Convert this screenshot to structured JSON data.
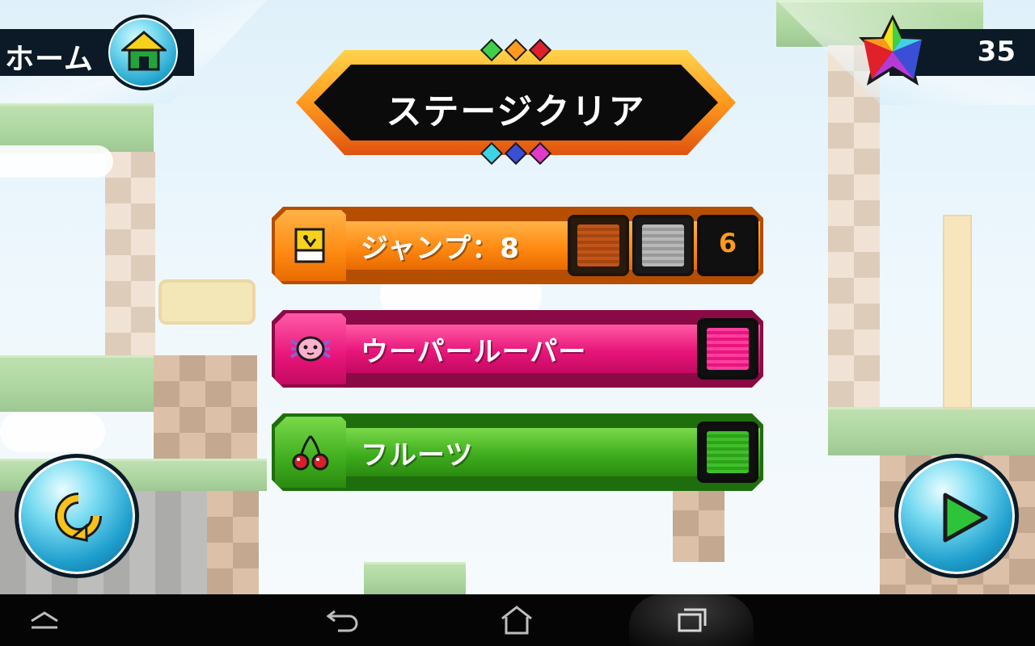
{
  "hud": {
    "home_label": "ホーム",
    "gem_count": "35"
  },
  "title": {
    "text": "ステージクリア",
    "top_diamond_colors": [
      "#3fcf4a",
      "#ff9a1e",
      "#e0202a"
    ],
    "bottom_diamond_colors": [
      "#3fd3e6",
      "#3b4fd6",
      "#e03bc8"
    ]
  },
  "missions": [
    {
      "label": "ジャンプ：8",
      "icon": "jump-card-icon",
      "color": "#ff8a12",
      "medals": [
        {
          "type": "bronze-medal-icon",
          "color": "#c2551a"
        },
        {
          "type": "silver-medal-icon",
          "color": "#a8a8a8"
        },
        {
          "type": "count",
          "value": "6"
        }
      ]
    },
    {
      "label": "ウーパールーパー",
      "icon": "axolotl-icon",
      "color": "#e8157a",
      "medals": [
        {
          "type": "axolotl-medal-icon",
          "color": "#e8157a"
        }
      ]
    },
    {
      "label": "フルーツ",
      "icon": "cherry-icon",
      "color": "#3fae1e",
      "medals": [
        {
          "type": "fruit-medal-icon",
          "color": "#2fa11a"
        }
      ]
    }
  ],
  "buttons": {
    "retry": "retry-icon",
    "next": "play-icon"
  },
  "navbar": [
    "menu-up-icon",
    "back-icon",
    "home-nav-icon",
    "recents-icon"
  ]
}
